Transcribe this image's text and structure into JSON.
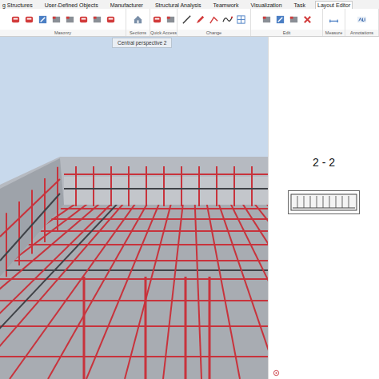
{
  "menu": [
    {
      "label": "g Structures",
      "selected": false
    },
    {
      "label": "User-Defined Objects",
      "selected": false
    },
    {
      "label": "Manufacturer",
      "selected": false
    },
    {
      "label": "Structural Analysis",
      "selected": false
    },
    {
      "label": "Teamwork",
      "selected": false
    },
    {
      "label": "Visualization",
      "selected": false
    },
    {
      "label": "Task",
      "selected": false
    },
    {
      "label": "Layout Editor",
      "selected": true
    }
  ],
  "ribbon": {
    "groups": [
      {
        "label": "Masonry"
      },
      {
        "label": "Sections"
      },
      {
        "label": "Quick Access"
      },
      {
        "label": "Change"
      },
      {
        "label": "Edit"
      },
      {
        "label": "Measure"
      },
      {
        "label": "Annotations"
      }
    ]
  },
  "viewport": {
    "title": "Central perspective 2"
  },
  "section": {
    "label": "2 - 2"
  }
}
